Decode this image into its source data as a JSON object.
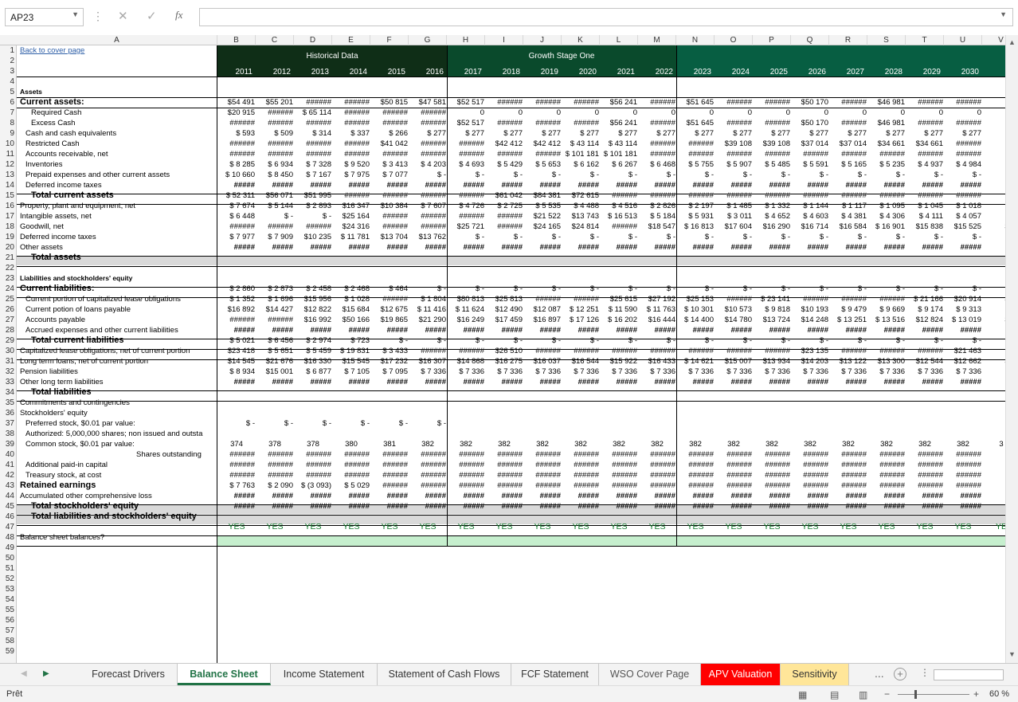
{
  "formula_bar": {
    "name_box": "AP23",
    "fx": "fx",
    "content": ""
  },
  "column_letters": [
    "A",
    "B",
    "C",
    "D",
    "E",
    "F",
    "G",
    "H",
    "I",
    "J",
    "K",
    "L",
    "M",
    "N",
    "O",
    "P",
    "Q",
    "R",
    "S",
    "T",
    "U",
    "V"
  ],
  "headers": {
    "historical": "Historical Data",
    "growth1": "Growth Stage One",
    "years": [
      "2011",
      "2012",
      "2013",
      "2014",
      "2015",
      "2016",
      "2017",
      "2018",
      "2019",
      "2020",
      "2021",
      "2022",
      "2023",
      "2024",
      "2025",
      "2026",
      "2027",
      "2028",
      "2029",
      "2030",
      "20"
    ]
  },
  "labels": {
    "r1": "Back to cover page",
    "r5": "Assets",
    "r6": "Current assets:",
    "r7": "Required Cash",
    "r8": "Excess Cash",
    "r9": "Cash and cash equivalents",
    "r10": "Restricted Cash",
    "r11": "Accounts receivable, net",
    "r12": "Inventories",
    "r13": "Prepaid expenses and other current assets",
    "r14": "Deferred income taxes",
    "r15": "Total current assets",
    "r16": "Property, plant and equipment, net",
    "r17": "Intangible assets, net",
    "r18": "Goodwill, net",
    "r19": "Deferred income taxes",
    "r20": "Other assets",
    "r21": "Total assets",
    "r23": "Liabilities and stockholders' equity",
    "r24": "Current liabilities:",
    "r25": "Current portion of capitalized lease obligations",
    "r26": "Current potion of loans payable",
    "r27": "Accounts payable",
    "r28": "Accrued expenses and other current liabilities",
    "r29": "Total current liabilities",
    "r30": "Capitalized lease obligations, net of current portion",
    "r31": "Long term loans, net of current portion",
    "r32": "Pension liabilities",
    "r33": "Other long term liabilities",
    "r34": "Total liabilities",
    "r35": "Commitments and contingencies",
    "r36": "Stockholders' equity",
    "r37": "Preferred stock, $0.01 par value:",
    "r38": "Authorized: 5,000,000 shares; non issued and outsta",
    "r39": "Common stock, $0.01 par value:",
    "r40": "Shares outstanding",
    "r41": "Additional paid-in capital",
    "r42": "Treasury stock, at cost",
    "r43": "Retained earnings",
    "r44": "Accumulated other comprehensive loss",
    "r45": "Total stockholders' equity",
    "r46": "Total liabilities and stockholders' equity",
    "r48": "Balance sheet balances?"
  },
  "values": {
    "r7": [
      "$54 491",
      "$55 201",
      "######",
      "######",
      "$50 815",
      "$47 581",
      "$52 517",
      "######",
      "######",
      "######",
      "$56 241",
      "######",
      "$51 645",
      "######",
      "######",
      "$50 170",
      "######",
      "$46 981",
      "######",
      "######",
      "###"
    ],
    "r8": [
      "$20 915",
      "######",
      "$ 65 114",
      "######",
      "######",
      "######",
      "0",
      "0",
      "0",
      "0",
      "0",
      "0",
      "0",
      "0",
      "0",
      "0",
      "0",
      "0",
      "0",
      "0",
      ""
    ],
    "r9": [
      "######",
      "######",
      "######",
      "######",
      "######",
      "######",
      "$52 517",
      "######",
      "######",
      "######",
      "$56 241",
      "######",
      "$51 645",
      "######",
      "######",
      "$50 170",
      "######",
      "$46 981",
      "######",
      "######",
      "###"
    ],
    "r10": [
      "$ 593",
      "$ 509",
      "$ 314",
      "$ 337",
      "$ 266",
      "$ 277",
      "$ 277",
      "$ 277",
      "$ 277",
      "$ 277",
      "$ 277",
      "$ 277",
      "$ 277",
      "$ 277",
      "$ 277",
      "$ 277",
      "$ 277",
      "$ 277",
      "$ 277",
      "$ 277",
      "$"
    ],
    "r11": [
      "######",
      "######",
      "######",
      "######",
      "$41 042",
      "######",
      "######",
      "$42 412",
      "$42 412",
      "$ 43 114",
      "$ 43 114",
      "######",
      "######",
      "$39 108",
      "$39 108",
      "$37 014",
      "$37 014",
      "$34 661",
      "$34 661",
      "######",
      "###"
    ],
    "r12": [
      "######",
      "######",
      "######",
      "######",
      "######",
      "######",
      "######",
      "######",
      "######",
      "$ 101 181",
      "$ 101 181",
      "######",
      "######",
      "######",
      "######",
      "######",
      "######",
      "######",
      "######",
      "######",
      "###"
    ],
    "r13": [
      "$ 8 285",
      "$ 6 934",
      "$ 7 328",
      "$ 9 520",
      "$ 3 413",
      "$ 4 203",
      "$ 4 693",
      "$ 5 429",
      "$ 5 653",
      "$ 6 162",
      "$ 6 267",
      "$ 6 468",
      "$ 5 755",
      "$ 5 907",
      "$ 5 485",
      "$ 5 591",
      "$ 5 165",
      "$ 5 235",
      "$ 4 937",
      "$ 4 984",
      "$ 4"
    ],
    "r14": [
      "$ 10 660",
      "$ 8 450",
      "$ 7 167",
      "$ 7 975",
      "$ 7 077",
      "$ -",
      "$ -",
      "$ -",
      "$ -",
      "$ -",
      "$ -",
      "$ -",
      "$ -",
      "$ -",
      "$ -",
      "$ -",
      "$ -",
      "$ -",
      "$ -",
      "$ -",
      "$"
    ],
    "r15": [
      "#####",
      "#####",
      "#####",
      "#####",
      "#####",
      "#####",
      "#####",
      "#####",
      "#####",
      "#####",
      "#####",
      "#####",
      "#####",
      "#####",
      "#####",
      "#####",
      "#####",
      "#####",
      "#####",
      "#####",
      "##"
    ],
    "r16": [
      "$ 52 311",
      "$56 071",
      "$51 995",
      "######",
      "######",
      "######",
      "######",
      "$61 042",
      "$84 381",
      "$72 615",
      "######",
      "######",
      "######",
      "######",
      "######",
      "######",
      "######",
      "######",
      "######",
      "######",
      "$90"
    ],
    "r17": [
      "$ 7 674",
      "$ 5 144",
      "$ 2 893",
      "$16 347",
      "$10 384",
      "$ 7 607",
      "$ 4 726",
      "$ 2 725",
      "$ 5 535",
      "$ 4 488",
      "$ 4 516",
      "$ 2 826",
      "$ 2 197",
      "$ 1 485",
      "$ 1 332",
      "$ 1 144",
      "$ 1 117",
      "$ 1 095",
      "$ 1 045",
      "$ 1 018",
      "$"
    ],
    "r18": [
      "$ 6 448",
      "$ -",
      "$ -",
      "$25 164",
      "######",
      "######",
      "######",
      "######",
      "$21 522",
      "$13 743",
      "$ 16 513",
      "$ 5 184",
      "$ 5 931",
      "$ 3 011",
      "$ 4 652",
      "$ 4 603",
      "$ 4 381",
      "$ 4 306",
      "$ 4 111",
      "$ 4 057",
      "$ 3"
    ],
    "r19": [
      "######",
      "######",
      "######",
      "$24 316",
      "######",
      "######",
      "$25 721",
      "######",
      "$24 165",
      "$24 814",
      "######",
      "$18 547",
      "$ 16 813",
      "$17 604",
      "$16 290",
      "$16 714",
      "$16 584",
      "$ 16 901",
      "$15 838",
      "$15 525",
      "$ 14"
    ],
    "r20": [
      "$ 7 977",
      "$ 7 909",
      "$10 235",
      "$ 11 781",
      "$13 704",
      "$13 762",
      "$ -",
      "$ -",
      "$ -",
      "$ -",
      "$ -",
      "$ -",
      "$ -",
      "$ -",
      "$ -",
      "$ -",
      "$ -",
      "$ -",
      "$ -",
      "$ -",
      "$"
    ],
    "r21": [
      "#####",
      "#####",
      "#####",
      "#####",
      "#####",
      "#####",
      "#####",
      "#####",
      "#####",
      "#####",
      "#####",
      "#####",
      "#####",
      "#####",
      "#####",
      "#####",
      "#####",
      "#####",
      "#####",
      "#####",
      "##"
    ],
    "r25": [
      "$ 2 860",
      "$ 2 873",
      "$ 2 458",
      "$ 2 468",
      "$ 464",
      "$ -",
      "$ -",
      "$ -",
      "$ -",
      "$ -",
      "$ -",
      "$ -",
      "$ -",
      "$ -",
      "$ -",
      "$ -",
      "$ -",
      "$ -",
      "$ -",
      "$ -",
      "$"
    ],
    "r26": [
      "$ 1 352",
      "$ 1 696",
      "$15 956",
      "$ 1 028",
      "######",
      "$ 1 804",
      "$80 813",
      "$25 813",
      "######",
      "######",
      "$25 615",
      "$27 192",
      "$25 153",
      "######",
      "$ 23 141",
      "######",
      "######",
      "######",
      "$ 21 166",
      "$20 914",
      "$ 19"
    ],
    "r27": [
      "$16 892",
      "$14 427",
      "$12 822",
      "$15 684",
      "$12 675",
      "$ 11 416",
      "$ 11 624",
      "$12 490",
      "$12 087",
      "$ 12 251",
      "$ 11 590",
      "$ 11 763",
      "$ 10 301",
      "$10 573",
      "$ 9 818",
      "$10 193",
      "$ 9 479",
      "$ 9 669",
      "$ 9 174",
      "$ 9 313",
      "$ 8"
    ],
    "r28": [
      "######",
      "######",
      "$16 992",
      "$50 166",
      "$19 865",
      "$21 290",
      "$16 249",
      "$17 459",
      "$16 897",
      "$ 17 126",
      "$ 16 202",
      "$16 444",
      "$ 14 400",
      "$14 780",
      "$13 724",
      "$14 248",
      "$ 13 251",
      "$ 13 516",
      "$12 824",
      "$ 13 019",
      "$ 12"
    ],
    "r29": [
      "#####",
      "#####",
      "#####",
      "#####",
      "#####",
      "#####",
      "#####",
      "#####",
      "#####",
      "#####",
      "#####",
      "#####",
      "#####",
      "#####",
      "#####",
      "#####",
      "#####",
      "#####",
      "#####",
      "#####",
      "##"
    ],
    "r30": [
      "$ 5 021",
      "$ 6 456",
      "$ 2 974",
      "$ 723",
      "$ -",
      "$ -",
      "$ -",
      "$ -",
      "$ -",
      "$ -",
      "$ -",
      "$ -",
      "$ -",
      "$ -",
      "$ -",
      "$ -",
      "$ -",
      "$ -",
      "$ -",
      "$ -",
      "$"
    ],
    "r31": [
      "$23 418",
      "$ 5 651",
      "$ 5 459",
      "$ 19 831",
      "$ 3 433",
      "######",
      "######",
      "$26 510",
      "######",
      "######",
      "######",
      "######",
      "######",
      "######",
      "######",
      "$23 135",
      "######",
      "######",
      "######",
      "$21 463",
      "$21"
    ],
    "r32": [
      "$14 545",
      "$21 676",
      "$16 330",
      "$15 545",
      "$17 232",
      "$16 307",
      "$14 868",
      "$16 275",
      "$16 037",
      "$16 544",
      "$15 922",
      "$16 433",
      "$ 14 621",
      "$15 007",
      "$13 934",
      "$14 203",
      "$13 122",
      "$13 300",
      "$12 544",
      "$12 662",
      "$ 12"
    ],
    "r33": [
      "$ 8 934",
      "$15 001",
      "$ 6 877",
      "$ 7 105",
      "$ 7 095",
      "$ 7 336",
      "$ 7 336",
      "$ 7 336",
      "$ 7 336",
      "$ 7 336",
      "$ 7 336",
      "$ 7 336",
      "$ 7 336",
      "$ 7 336",
      "$ 7 336",
      "$ 7 336",
      "$ 7 336",
      "$ 7 336",
      "$ 7 336",
      "$ 7 336",
      "$ 7"
    ],
    "r34": [
      "#####",
      "#####",
      "#####",
      "#####",
      "#####",
      "#####",
      "#####",
      "#####",
      "#####",
      "#####",
      "#####",
      "#####",
      "#####",
      "#####",
      "#####",
      "#####",
      "#####",
      "#####",
      "#####",
      "#####",
      "##"
    ],
    "r38": [
      "$ -",
      "$ -",
      "$ -",
      "$ -",
      "$ -",
      "$ -"
    ],
    "r40": [
      "374",
      "378",
      "378",
      "380",
      "381",
      "382",
      "382",
      "382",
      "382",
      "382",
      "382",
      "382",
      "382",
      "382",
      "382",
      "382",
      "382",
      "382",
      "382",
      "382",
      "3"
    ],
    "r41": [
      "######",
      "######",
      "######",
      "######",
      "######",
      "######",
      "######",
      "######",
      "######",
      "######",
      "######",
      "######",
      "######",
      "######",
      "######",
      "######",
      "######",
      "######",
      "######",
      "######",
      "###"
    ],
    "r42": [
      "######",
      "######",
      "######",
      "######",
      "######",
      "######",
      "######",
      "######",
      "######",
      "######",
      "######",
      "######",
      "######",
      "######",
      "######",
      "######",
      "######",
      "######",
      "######",
      "######",
      "###"
    ],
    "r43": [
      "######",
      "######",
      "######",
      "######",
      "######",
      "######",
      "######",
      "######",
      "######",
      "######",
      "######",
      "######",
      "######",
      "######",
      "######",
      "######",
      "######",
      "######",
      "######",
      "######",
      "###"
    ],
    "r44": [
      "$ 7 763",
      "$ 2 090",
      "$ (3 093)",
      "$ 5 029",
      "######",
      "######",
      "######",
      "######",
      "######",
      "######",
      "######",
      "######",
      "######",
      "######",
      "######",
      "######",
      "######",
      "######",
      "######",
      "######",
      "###"
    ],
    "r45": [
      "#####",
      "#####",
      "#####",
      "#####",
      "#####",
      "#####",
      "#####",
      "#####",
      "#####",
      "#####",
      "#####",
      "#####",
      "#####",
      "#####",
      "#####",
      "#####",
      "#####",
      "#####",
      "#####",
      "#####",
      "##"
    ],
    "r46": [
      "#####",
      "#####",
      "#####",
      "#####",
      "#####",
      "#####",
      "#####",
      "#####",
      "#####",
      "#####",
      "#####",
      "#####",
      "#####",
      "#####",
      "#####",
      "#####",
      "#####",
      "#####",
      "#####",
      "#####",
      "##"
    ],
    "r48": [
      "YES",
      "YES",
      "YES",
      "YES",
      "YES",
      "YES",
      "YES",
      "YES",
      "YES",
      "YES",
      "YES",
      "YES",
      "YES",
      "YES",
      "YES",
      "YES",
      "YES",
      "YES",
      "YES",
      "YES",
      "YE"
    ]
  },
  "tabs": [
    {
      "label": "Forecast Drivers",
      "style": "normal"
    },
    {
      "label": "Balance Sheet",
      "style": "active"
    },
    {
      "label": "Income Statement",
      "style": "normal"
    },
    {
      "label": "Statement of Cash Flows",
      "style": "normal"
    },
    {
      "label": "FCF Statement",
      "style": "normal"
    },
    {
      "label": "WSO Cover Page",
      "style": "grey"
    },
    {
      "label": "APV Valuation",
      "style": "red"
    },
    {
      "label": "Sensitivity",
      "style": "yellow"
    }
  ],
  "tab_more": "...",
  "status": {
    "ready": "Prêt",
    "zoom": "60 %"
  },
  "colors": {
    "dark_green": "#0f2e17",
    "mid_green": "#0a4a2c",
    "teal_green": "#075e42",
    "yes_bg": "#c6efce",
    "yes_text": "#137a2e",
    "active_tab": "#217346",
    "red_tab": "#ff0000",
    "yellow_tab": "#ffe699"
  },
  "icons": {
    "name_dropdown": "chevron-down-icon",
    "cancel": "x-icon",
    "enter": "check-icon",
    "function": "fx-icon",
    "tab_nav": "triangle-right-icon",
    "add_sheet": "plus-circle-icon"
  }
}
